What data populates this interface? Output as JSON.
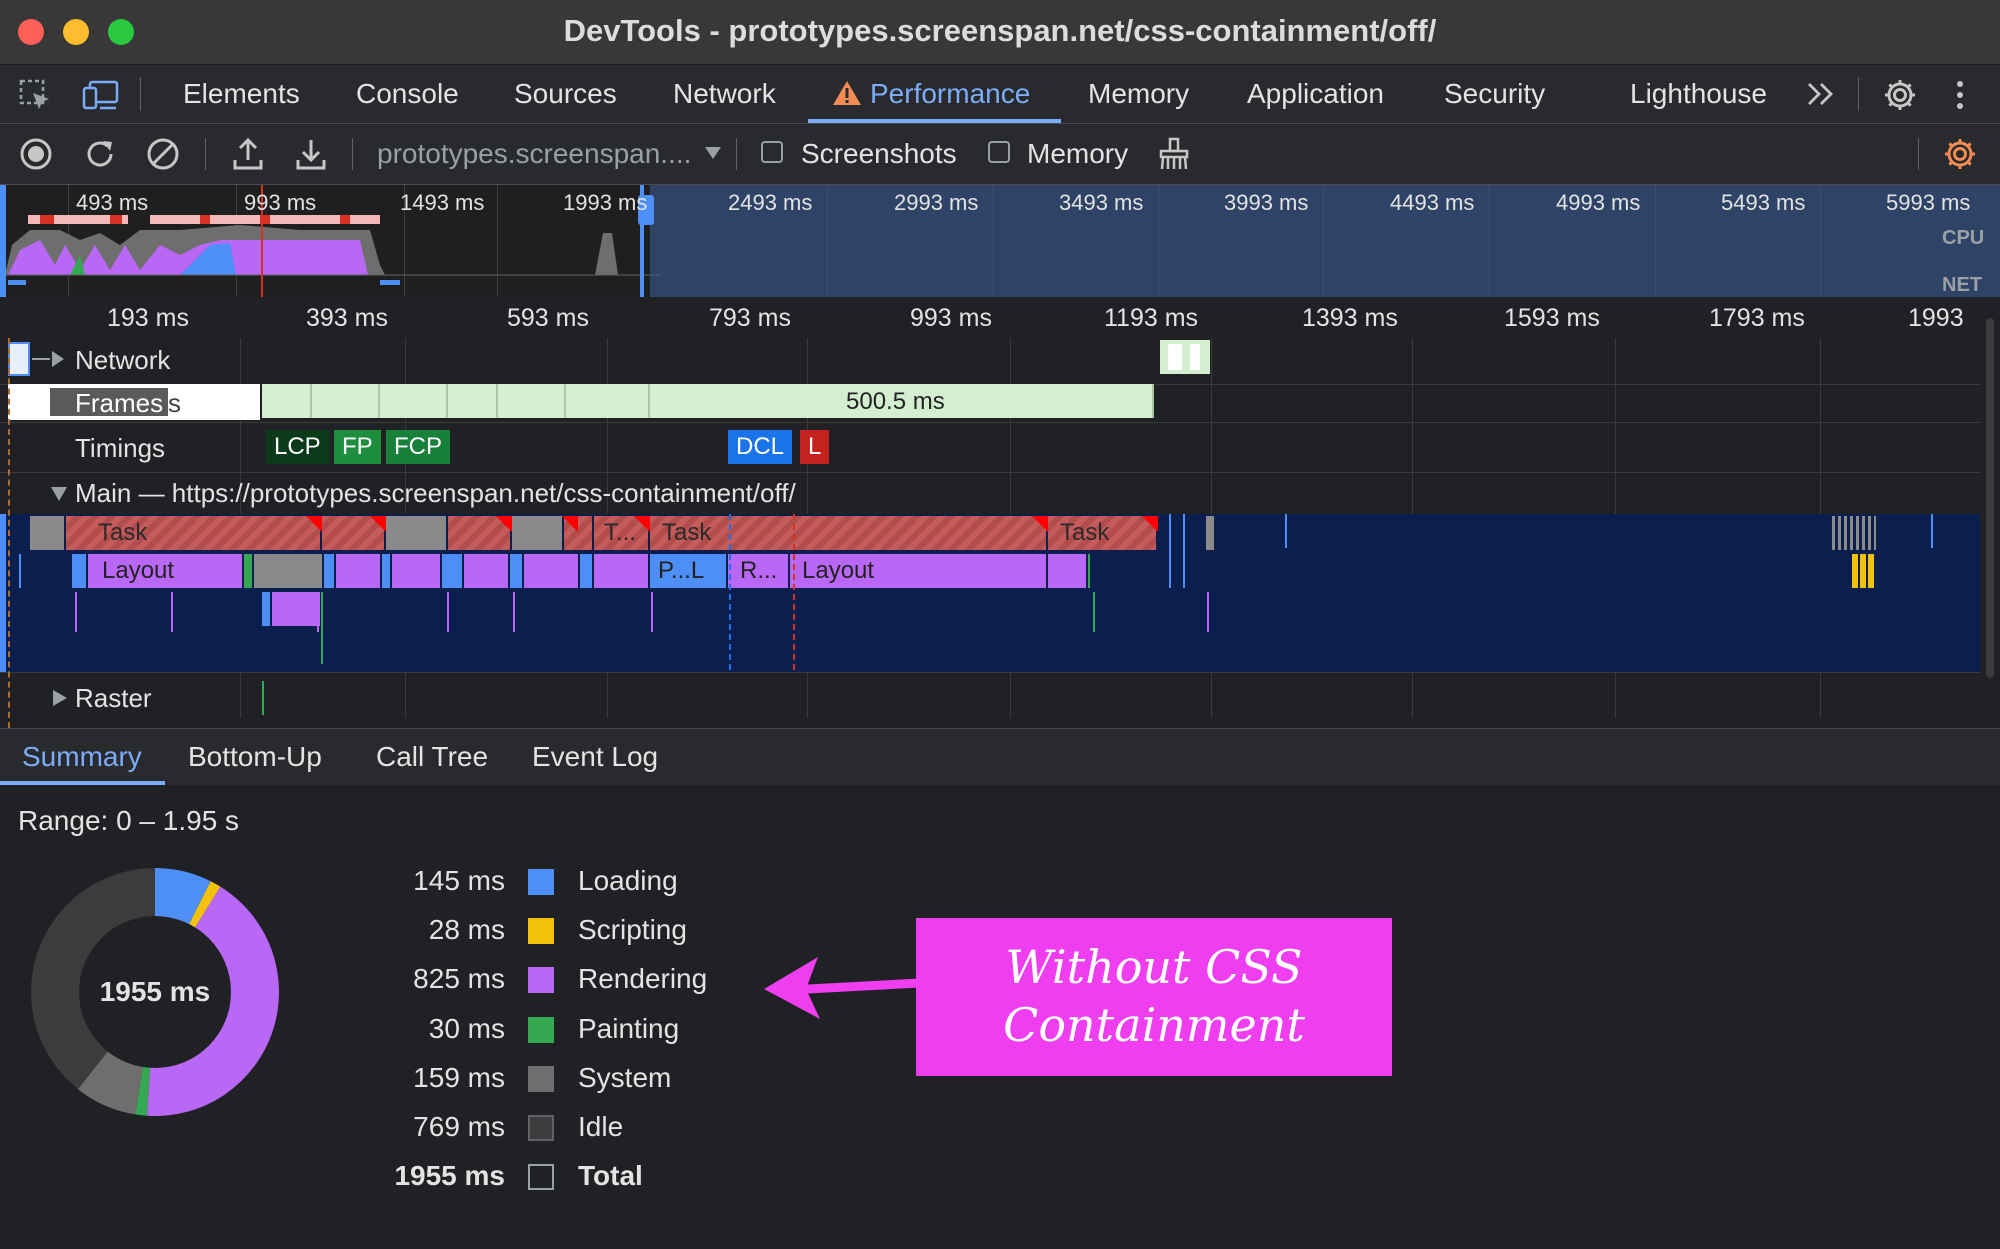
{
  "window": {
    "title": "DevTools - prototypes.screenspan.net/css-containment/off/"
  },
  "tabs": [
    {
      "label": "Elements"
    },
    {
      "label": "Console"
    },
    {
      "label": "Sources"
    },
    {
      "label": "Network"
    },
    {
      "label": "Performance",
      "active": true,
      "warning": true
    },
    {
      "label": "Memory"
    },
    {
      "label": "Application"
    },
    {
      "label": "Security"
    },
    {
      "label": "Lighthouse"
    }
  ],
  "toolbar": {
    "url_select": "prototypes.screenspan....",
    "screenshots_label": "Screenshots",
    "screenshots_checked": false,
    "memory_label": "Memory",
    "memory_checked": false
  },
  "overview": {
    "tick_labels": [
      "493 ms",
      "993 ms",
      "1493 ms",
      "1993 ms",
      "2493 ms",
      "2993 ms",
      "3493 ms",
      "3993 ms",
      "4493 ms",
      "4993 ms",
      "5493 ms",
      "5993 ms"
    ],
    "cpu_label": "CPU",
    "net_label": "NET"
  },
  "ruler": {
    "labels": [
      "193 ms",
      "393 ms",
      "593 ms",
      "793 ms",
      "993 ms",
      "1193 ms",
      "1393 ms",
      "1593 ms",
      "1793 ms",
      "1993"
    ]
  },
  "tracks": {
    "network": "Network",
    "frames": "Frames",
    "frames_suffix": "s",
    "frame_duration": "500.5 ms",
    "timings": "Timings",
    "timing_marks": [
      "LCP",
      "FP",
      "FCP",
      "DCL",
      "L"
    ],
    "main": "Main — https://prototypes.screenspan.net/css-containment/off/",
    "raster": "Raster",
    "task_labels": [
      "Task",
      "T...",
      "Task",
      "Task"
    ],
    "sub_labels": [
      "Layout",
      "P...L",
      "R...",
      "Layout"
    ]
  },
  "bottom_tabs": [
    "Summary",
    "Bottom-Up",
    "Call Tree",
    "Event Log"
  ],
  "summary": {
    "range": "Range: 0 – 1.95 s",
    "donut_total": "1955 ms",
    "legend": [
      {
        "value": "145 ms",
        "name": "Loading",
        "color": "#4d8ef7"
      },
      {
        "value": "28 ms",
        "name": "Scripting",
        "color": "#f4c20d"
      },
      {
        "value": "825 ms",
        "name": "Rendering",
        "color": "#b967f5"
      },
      {
        "value": "30 ms",
        "name": "Painting",
        "color": "#34a853"
      },
      {
        "value": "159 ms",
        "name": "System",
        "color": "#6e6e6e"
      },
      {
        "value": "769 ms",
        "name": "Idle",
        "color": "#3c3c3c"
      },
      {
        "value": "1955 ms",
        "name": "Total",
        "color": "transparent"
      }
    ]
  },
  "annotation": {
    "line1": "Without CSS",
    "line2": "Containment",
    "color": "#ee3ef0"
  },
  "colors": {
    "accent": "#7cacf8",
    "warning": "#f28b54"
  }
}
